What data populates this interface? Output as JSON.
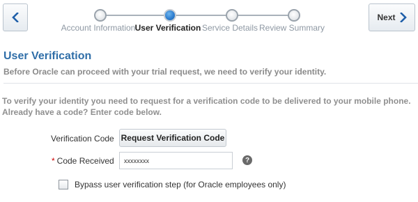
{
  "nav": {
    "back_icon": "chevron-left-icon",
    "next_label": "Next",
    "next_icon": "chevron-right-icon",
    "accent_color": "#1f5fa9"
  },
  "train": {
    "steps": [
      {
        "label": "Account Information",
        "state": "visited"
      },
      {
        "label": "User Verification",
        "state": "current"
      },
      {
        "label": "Service Details",
        "state": "unvisited"
      },
      {
        "label": "Review Summary",
        "state": "unvisited"
      }
    ]
  },
  "header": {
    "title": "User Verification",
    "subtitle": "Before Oracle can proceed with your trial request, we need to verify your identity."
  },
  "instructions": "To verify your identity you need to request for a verification code to be delivered to your mobile phone. Already have a code? Enter code below.",
  "form": {
    "verification_code_label": "Verification Code",
    "request_button_label": "Request Verification Code",
    "required_marker": "*",
    "code_received_label": "Code Received",
    "code_received_value": "xxxxxxxx",
    "help_icon": "question-circle-icon",
    "help_glyph": "?",
    "bypass_label": "Bypass user verification step (for Oracle employees only)",
    "bypass_checked": false
  }
}
